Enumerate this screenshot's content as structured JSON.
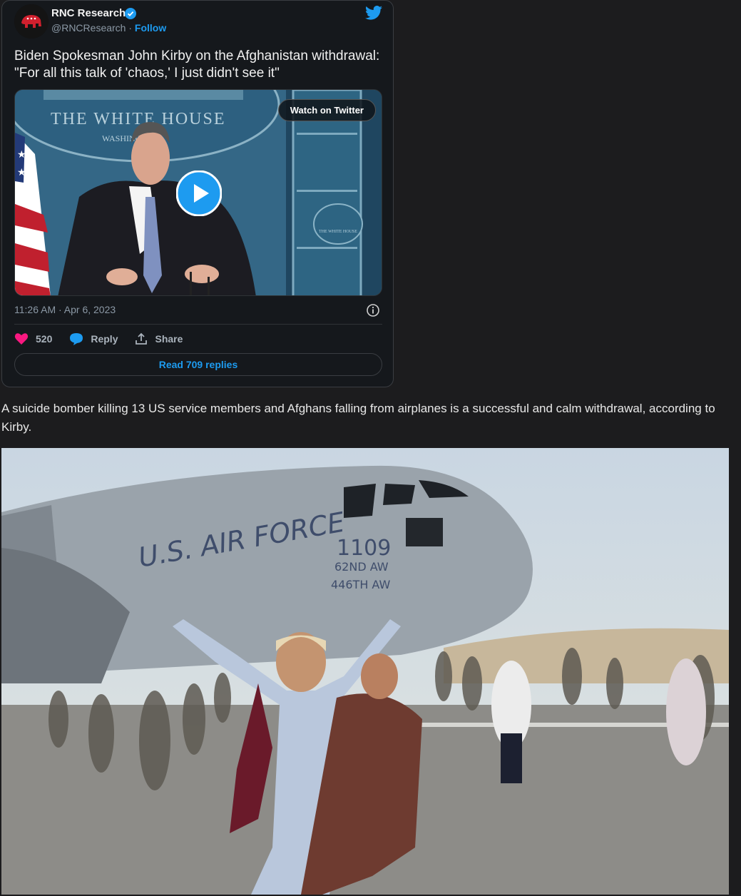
{
  "tweet": {
    "author_name": "RNC Research",
    "handle": "@RNCResearch",
    "separator": "·",
    "follow_label": "Follow",
    "text": "Biden Spokesman John Kirby on the Afghanistan withdrawal: \"For all this talk of 'chaos,' I just didn't see it\"",
    "media": {
      "watch_label": "Watch on Twitter",
      "podium_text": "THE WHITE HOUSE",
      "podium_subtext": "WASHINGTON",
      "seal_text": "THE WHITE HOUSE"
    },
    "timestamp": "11:26 AM · Apr 6, 2023",
    "likes": "520",
    "reply_label": "Reply",
    "share_label": "Share",
    "read_replies_label": "Read 709 replies"
  },
  "caption": "A suicide bomber killing 13 US service members and Afghans falling from airplanes is a successful and calm withdrawal, according to Kirby.",
  "photo": {
    "fuselage_text": "U.S. AIR FORCE",
    "tail_number": "1109",
    "wing_line1": "62ND AW",
    "wing_line2": "446TH AW"
  },
  "colors": {
    "accent": "#1d9bf0",
    "heart": "#f91880",
    "background": "#1c1c1e"
  }
}
